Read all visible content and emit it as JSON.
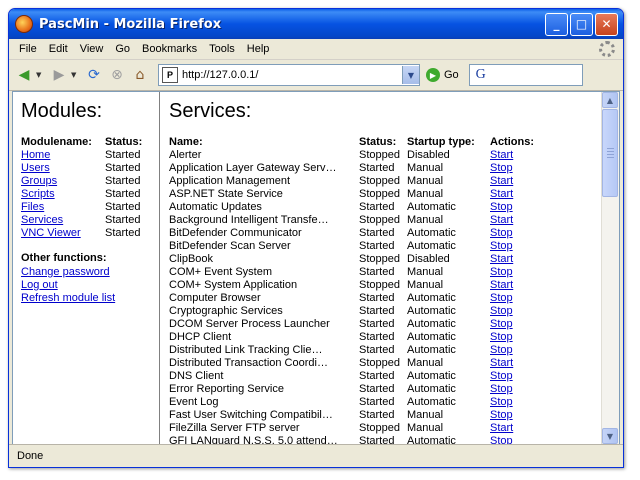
{
  "window": {
    "title": "PascMin - Mozilla Firefox"
  },
  "menubar": [
    "File",
    "Edit",
    "View",
    "Go",
    "Bookmarks",
    "Tools",
    "Help"
  ],
  "navbar": {
    "url": "http://127.0.0.1/",
    "go_label": "Go"
  },
  "modules": {
    "heading": "Modules:",
    "col_name": "Modulename:",
    "col_status": "Status:",
    "items": [
      {
        "name": "Home",
        "status": "Started"
      },
      {
        "name": "Users",
        "status": "Started"
      },
      {
        "name": "Groups",
        "status": "Started"
      },
      {
        "name": "Scripts",
        "status": "Started"
      },
      {
        "name": "Files",
        "status": "Started"
      },
      {
        "name": "Services",
        "status": "Started"
      },
      {
        "name": "VNC Viewer",
        "status": "Started"
      }
    ]
  },
  "other_functions": {
    "heading": "Other functions:",
    "links": [
      "Change password",
      "Log out",
      "Refresh module list"
    ]
  },
  "services": {
    "heading": "Services:",
    "col_name": "Name:",
    "col_status": "Status:",
    "col_startup": "Startup type:",
    "col_actions": "Actions:",
    "rows": [
      {
        "name": "Alerter",
        "status": "Stopped",
        "startup": "Disabled",
        "action": "Start"
      },
      {
        "name": "Application Layer Gateway Serv…",
        "status": "Started",
        "startup": "Manual",
        "action": "Stop"
      },
      {
        "name": "Application Management",
        "status": "Stopped",
        "startup": "Manual",
        "action": "Start"
      },
      {
        "name": "ASP.NET State Service",
        "status": "Stopped",
        "startup": "Manual",
        "action": "Start"
      },
      {
        "name": "Automatic Updates",
        "status": "Started",
        "startup": "Automatic",
        "action": "Stop"
      },
      {
        "name": "Background Intelligent Transfe…",
        "status": "Stopped",
        "startup": "Manual",
        "action": "Start"
      },
      {
        "name": "BitDefender Communicator",
        "status": "Started",
        "startup": "Automatic",
        "action": "Stop"
      },
      {
        "name": "BitDefender Scan Server",
        "status": "Started",
        "startup": "Automatic",
        "action": "Stop"
      },
      {
        "name": "ClipBook",
        "status": "Stopped",
        "startup": "Disabled",
        "action": "Start"
      },
      {
        "name": "COM+ Event System",
        "status": "Started",
        "startup": "Manual",
        "action": "Stop"
      },
      {
        "name": "COM+ System Application",
        "status": "Stopped",
        "startup": "Manual",
        "action": "Start"
      },
      {
        "name": "Computer Browser",
        "status": "Started",
        "startup": "Automatic",
        "action": "Stop"
      },
      {
        "name": "Cryptographic Services",
        "status": "Started",
        "startup": "Automatic",
        "action": "Stop"
      },
      {
        "name": "DCOM Server Process Launcher",
        "status": "Started",
        "startup": "Automatic",
        "action": "Stop"
      },
      {
        "name": "DHCP Client",
        "status": "Started",
        "startup": "Automatic",
        "action": "Stop"
      },
      {
        "name": "Distributed Link Tracking Clie…",
        "status": "Started",
        "startup": "Automatic",
        "action": "Stop"
      },
      {
        "name": "Distributed Transaction Coordi…",
        "status": "Stopped",
        "startup": "Manual",
        "action": "Start"
      },
      {
        "name": "DNS Client",
        "status": "Started",
        "startup": "Automatic",
        "action": "Stop"
      },
      {
        "name": "Error Reporting Service",
        "status": "Started",
        "startup": "Automatic",
        "action": "Stop"
      },
      {
        "name": "Event Log",
        "status": "Started",
        "startup": "Automatic",
        "action": "Stop"
      },
      {
        "name": "Fast User Switching Compatibil…",
        "status": "Started",
        "startup": "Manual",
        "action": "Stop"
      },
      {
        "name": "FileZilla Server FTP server",
        "status": "Stopped",
        "startup": "Manual",
        "action": "Start"
      },
      {
        "name": "GFI LANguard N.S.S. 5.0 attend…",
        "status": "Started",
        "startup": "Automatic",
        "action": "Stop"
      }
    ]
  },
  "statusbar": {
    "text": "Done"
  }
}
